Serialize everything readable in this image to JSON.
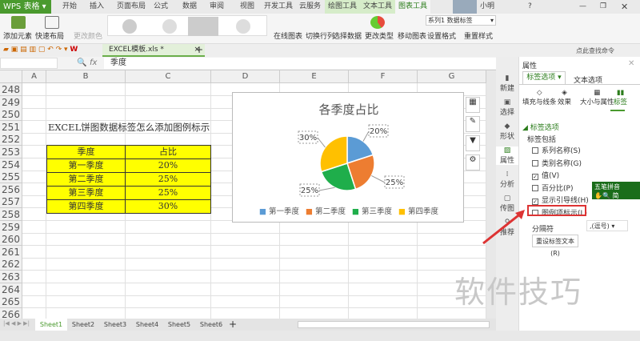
{
  "app": {
    "logo": "WPS 表格"
  },
  "menu": [
    "开始",
    "插入",
    "页面布局",
    "公式",
    "数据",
    "审阅",
    "视图",
    "开发工具",
    "云服务"
  ],
  "context_tabs": [
    "绘图工具",
    "文本工具",
    "图表工具"
  ],
  "user": {
    "name": "小明",
    "help": "?"
  },
  "ribbon": {
    "add_element": "添加元素",
    "quick_layout": "快速布局",
    "change_color": "更改颜色",
    "online_chart": "在线图表",
    "switch_row_col": "切换行列",
    "select_data": "选择数据",
    "change_type": "更改类型",
    "move_chart": "移动图表",
    "series_select": "系列1 数据标签",
    "set_format": "设置格式",
    "reset_style": "重置样式",
    "search_cmd": "点此查找命令"
  },
  "document": {
    "tab": "EXCEL模板.xls *"
  },
  "formula_bar": {
    "fx": "fx",
    "value": "季度"
  },
  "columns": [
    "A",
    "B",
    "C",
    "D",
    "E",
    "F",
    "G"
  ],
  "rows": [
    "248",
    "249",
    "250",
    "251",
    "252",
    "253",
    "254",
    "255",
    "256",
    "257",
    "258",
    "259",
    "260",
    "261",
    "262",
    "263",
    "264",
    "265",
    "266"
  ],
  "title_cell": "EXCEL饼图数据标签怎么添加图例标示",
  "table": {
    "headers": [
      "季度",
      "占比"
    ],
    "rows": [
      [
        "第一季度",
        "20%"
      ],
      [
        "第二季度",
        "25%"
      ],
      [
        "第三季度",
        "25%"
      ],
      [
        "第四季度",
        "30%"
      ]
    ]
  },
  "chart_data": {
    "type": "pie",
    "title": "各季度占比",
    "categories": [
      "第一季度",
      "第二季度",
      "第三季度",
      "第四季度"
    ],
    "values": [
      20,
      25,
      25,
      30
    ],
    "data_labels": [
      "20%",
      "25%",
      "25%",
      "30%"
    ],
    "colors": [
      "#5b9bd5",
      "#ed7d31",
      "#1fae4b",
      "#ffc000"
    ],
    "legend": "bottom"
  },
  "sidebar": [
    "新建",
    "选择",
    "形状",
    "属性",
    "分析",
    "传图",
    "推荐"
  ],
  "panel": {
    "title": "属性",
    "tabs": [
      "标签选项",
      "文本选项"
    ],
    "subtabs": [
      "填充与线条",
      "效果",
      "大小与属性",
      "标签"
    ],
    "section": "标签选项",
    "group": "标签包括",
    "options": [
      {
        "label": "系列名称(S)",
        "checked": false
      },
      {
        "label": "类别名称(G)",
        "checked": false
      },
      {
        "label": "值(V)",
        "checked": true
      },
      {
        "label": "百分比(P)",
        "checked": false
      },
      {
        "label": "显示引导线(H)",
        "checked": true
      },
      {
        "label": "图例项标示(L)",
        "checked": false
      }
    ],
    "separator_label": "分隔符",
    "separator_value": ",(逗号)",
    "reset_button": "重设标签文本(R)"
  },
  "ime": {
    "name": "五笔拼音",
    "mode": "简"
  },
  "sheets": [
    "Sheet1",
    "Sheet2",
    "Sheet3",
    "Sheet4",
    "Sheet5",
    "Sheet6"
  ],
  "watermark": "软件技巧"
}
